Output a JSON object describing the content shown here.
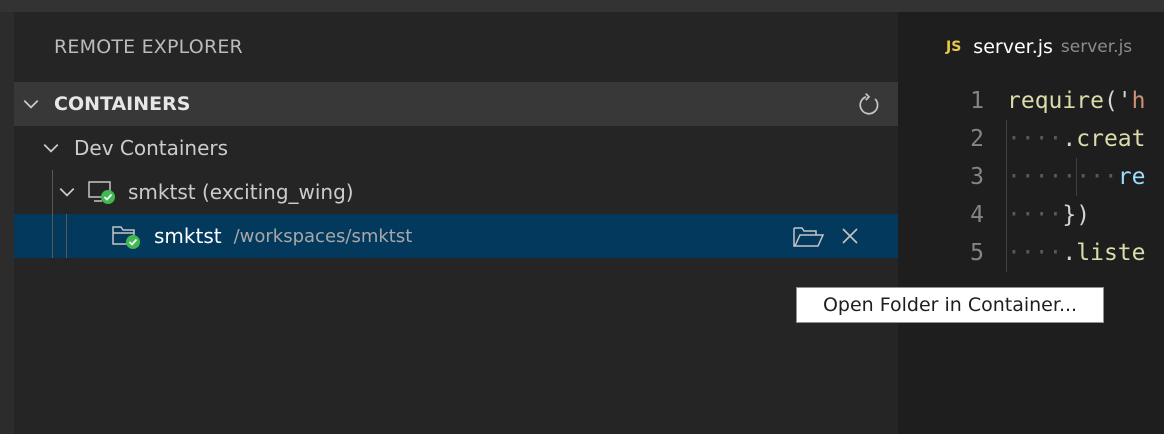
{
  "sidebar": {
    "title": "REMOTE EXPLORER",
    "section": {
      "title": "CONTAINERS",
      "refresh_icon": "refresh-icon"
    },
    "tree": {
      "group": {
        "label": "Dev Containers"
      },
      "container": {
        "label": "smktst (exciting_wing)",
        "icon": "remote-container-icon",
        "status": "running"
      },
      "folder": {
        "name": "smktst",
        "path": "/workspaces/smktst",
        "actions": {
          "open_folder_icon": "folder-opened-icon",
          "close_icon": "close-icon"
        }
      }
    }
  },
  "tooltip": {
    "text": "Open Folder in Container..."
  },
  "editor": {
    "tab": {
      "icon_text": "JS",
      "name": "server.js",
      "description": "server.js"
    },
    "lines": [
      {
        "number": "1",
        "indent": "",
        "parts": [
          {
            "t": "require",
            "c": "fn"
          },
          {
            "t": "('",
            "c": "pun"
          },
          {
            "t": "h",
            "c": "str"
          }
        ]
      },
      {
        "number": "2",
        "indent": "····",
        "parts": [
          {
            "t": ".",
            "c": "pun"
          },
          {
            "t": "creat",
            "c": "fn"
          }
        ]
      },
      {
        "number": "3",
        "indent": "········",
        "parts": [
          {
            "t": "re",
            "c": "var"
          }
        ]
      },
      {
        "number": "4",
        "indent": "····",
        "parts": [
          {
            "t": "})",
            "c": "pun"
          }
        ]
      },
      {
        "number": "5",
        "indent": "····",
        "parts": [
          {
            "t": ".",
            "c": "pun"
          },
          {
            "t": "liste",
            "c": "fn"
          }
        ]
      }
    ]
  },
  "colors": {
    "selection": "#04395e",
    "status_badge": "#3fb950",
    "js_icon": "#e8c84a",
    "sidebar_bg": "#252526",
    "editor_bg": "#1e1e1e"
  }
}
